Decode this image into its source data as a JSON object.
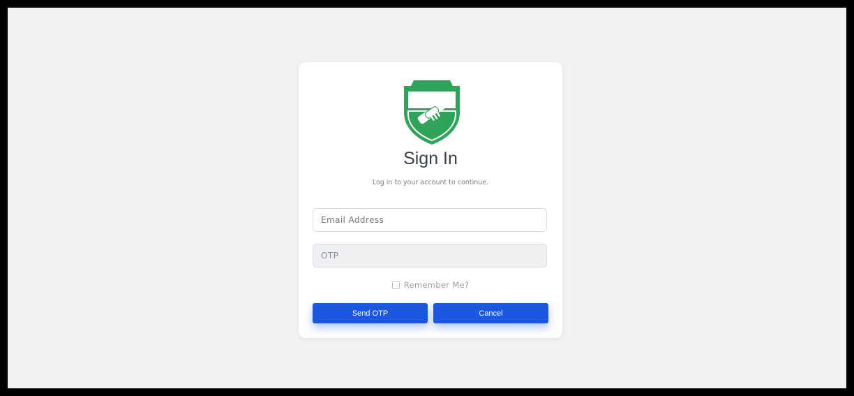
{
  "page": {
    "title": "Sign In",
    "subtitle": "Log in to your account to continue."
  },
  "form": {
    "email_placeholder": "Email Address",
    "email_value": "",
    "otp_placeholder": "OTP",
    "otp_value": "",
    "remember_label": "Remember Me?",
    "remember_checked": false,
    "send_label": "Send OTP",
    "cancel_label": "Cancel"
  },
  "logo": {
    "icon": "shield-handshake-icon"
  },
  "colors": {
    "brand_green": "#2fa35a",
    "primary_button": "#1c57e0",
    "background": "#f1f2f4"
  }
}
